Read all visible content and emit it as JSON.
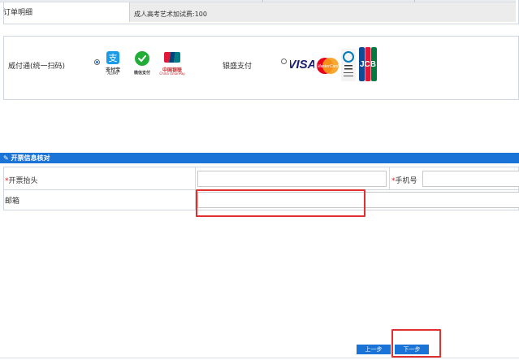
{
  "order": {
    "label": "订单明细",
    "value": "成人高考艺术加试费:100"
  },
  "payment": {
    "option1_label": "威付通(统一扫码)",
    "option1_checked": true,
    "alipay_caption": "支付宝",
    "alipay_sub": "ALIPAY",
    "wechat_caption": "微信支付",
    "unionpay_caption": "中国银联",
    "unionpay_sub": "China UnionPay",
    "option2_label": "银盛支付",
    "option2_checked": false,
    "cards": [
      "VISA",
      "MasterCard",
      "Diners Club International",
      "JCB"
    ]
  },
  "invoice": {
    "section_title": "开票信息核对",
    "title_label": "开票抬头",
    "title_value": "",
    "phone_label": "手机号",
    "phone_value": "",
    "email_label": "邮箱",
    "email_value": "",
    "required_mark": "*"
  },
  "nav": {
    "prev_label": "上一步",
    "next_label": "下一步"
  },
  "colors": {
    "accent": "#1a73d6",
    "highlight": "#e03030",
    "required": "#e02020"
  }
}
